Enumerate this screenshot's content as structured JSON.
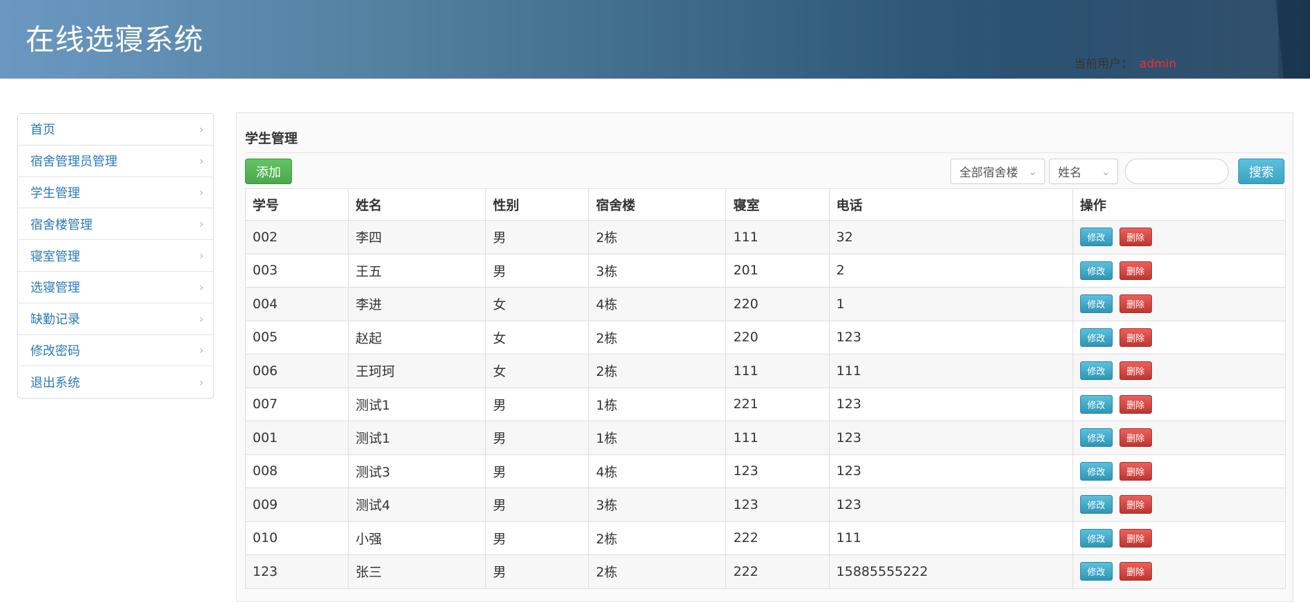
{
  "header": {
    "app_title": "在线选寝系统",
    "user_label": "当前用户：",
    "user_name": "admin"
  },
  "sidebar": {
    "items": [
      {
        "label": "首页"
      },
      {
        "label": "宿舍管理员管理"
      },
      {
        "label": "学生管理"
      },
      {
        "label": "宿舍楼管理"
      },
      {
        "label": "寝室管理"
      },
      {
        "label": "选寝管理"
      },
      {
        "label": "缺勤记录"
      },
      {
        "label": "修改密码"
      },
      {
        "label": "退出系统"
      }
    ]
  },
  "panel": {
    "title": "学生管理",
    "add_label": "添加",
    "building_select": "全部宿舍楼",
    "field_select": "姓名",
    "search_value": "",
    "search_label": "搜索"
  },
  "table": {
    "headers": [
      "学号",
      "姓名",
      "性别",
      "宿舍楼",
      "寝室",
      "电话",
      "操作"
    ],
    "edit_label": "修改",
    "delete_label": "删除",
    "rows": [
      [
        "002",
        "李四",
        "男",
        "2栋",
        "111",
        "32"
      ],
      [
        "003",
        "王五",
        "男",
        "3栋",
        "201",
        "2"
      ],
      [
        "004",
        "李进",
        "女",
        "4栋",
        "220",
        "1"
      ],
      [
        "005",
        "赵起",
        "女",
        "2栋",
        "220",
        "123"
      ],
      [
        "006",
        "王珂珂",
        "女",
        "2栋",
        "111",
        "111"
      ],
      [
        "007",
        "测试1",
        "男",
        "1栋",
        "221",
        "123"
      ],
      [
        "001",
        "测试1",
        "男",
        "1栋",
        "111",
        "123"
      ],
      [
        "008",
        "测试3",
        "男",
        "4栋",
        "123",
        "123"
      ],
      [
        "009",
        "测试4",
        "男",
        "3栋",
        "123",
        "123"
      ],
      [
        "010",
        "小强",
        "男",
        "2栋",
        "222",
        "111"
      ],
      [
        "123",
        "张三",
        "男",
        "2栋",
        "222",
        "15885555222"
      ]
    ]
  }
}
